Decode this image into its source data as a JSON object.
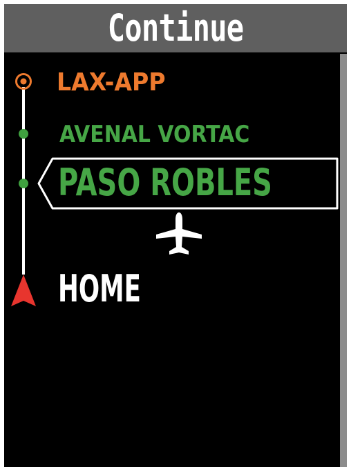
{
  "header": {
    "title": "Continue"
  },
  "route": {
    "waypoints": [
      {
        "label": "LAX-APP",
        "icon": "origin-circle-icon",
        "color": "#ee7a2e",
        "state": "completed"
      },
      {
        "label": "AVENAL VORTAC",
        "icon": "waypoint-dot-icon",
        "color": "#46a646",
        "state": "upcoming"
      },
      {
        "label": "PASO ROBLES",
        "icon": "waypoint-dot-icon",
        "color": "#46a646",
        "state": "active"
      },
      {
        "label": "HOME",
        "icon": "destination-arrow-icon",
        "color": "#ffffff",
        "state": "destination"
      }
    ]
  },
  "aircraft": {
    "icon": "airplane-icon"
  },
  "colors": {
    "background": "#000000",
    "title_bar": "#5f5f5f",
    "scrollbar": "#8c8c8c",
    "origin": "#ee7a2e",
    "waypoint": "#46a646",
    "destination_marker": "#e8352e"
  }
}
